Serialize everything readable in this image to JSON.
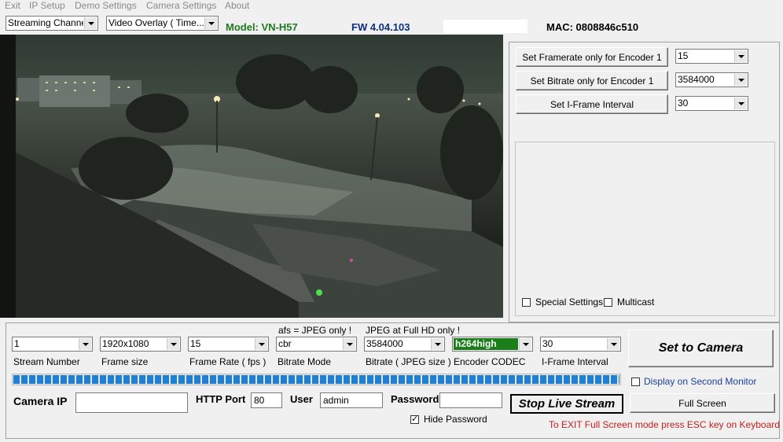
{
  "menu": {
    "items": [
      "Exit",
      "IP Setup",
      "Demo Settings",
      "Camera Settings",
      "About"
    ]
  },
  "toolbar": {
    "channel_select": "Streaming Channel",
    "overlay_select": "Video Overlay ( Time... )",
    "model": "Model: VN-H57",
    "firmware": "FW 4.04.103",
    "mac": "MAC: 0808846c510"
  },
  "encoder_panel": {
    "framerate_button": "Set Framerate only for Encoder 1",
    "framerate_value": "15",
    "bitrate_button": "Set Bitrate only for Encoder 1",
    "bitrate_value": "3584000",
    "iframe_button": "Set I-Frame Interval",
    "iframe_value": "30",
    "special_settings": "Special Settings",
    "multicast": "Multicast"
  },
  "stream": {
    "afs_note": "afs = JPEG only !",
    "jpeg_note": "JPEG at Full HD only !",
    "stream_number": {
      "value": "1",
      "label": "Stream Number"
    },
    "frame_size": {
      "value": "1920x1080",
      "label": "Frame size"
    },
    "frame_rate": {
      "value": "15",
      "label": "Frame Rate ( fps )"
    },
    "bitrate_mode": {
      "value": "cbr",
      "label": "Bitrate Mode"
    },
    "bitrate": {
      "value": "3584000",
      "label": "Bitrate ( JPEG size )"
    },
    "codec": {
      "value": "h264high",
      "label": "Encoder CODEC"
    },
    "iframe": {
      "value": "30",
      "label": "I-Frame Interval"
    },
    "set_to_camera": "Set to Camera",
    "display_second_monitor": "Display on Second Monitor",
    "progress": 1.0
  },
  "connection": {
    "camera_ip_label": "Camera IP",
    "camera_ip_value": "",
    "http_port_label": "HTTP Port",
    "http_port_value": "80",
    "user_label": "User",
    "user_value": "admin",
    "password_label": "Password",
    "password_value": "",
    "hide_password": "Hide Password",
    "stop_stream": "Stop Live Stream",
    "full_screen": "Full Screen",
    "exit_hint": "To EXIT Full Screen mode press ESC key on Keyboard"
  },
  "colors": {
    "model": "#1f7a1f",
    "firmware": "#0d2f80",
    "codec_bg": "#1a7f1a",
    "progress": "#1e7fd6",
    "hint": "#c81e1e",
    "link_blue": "#1a3f9e"
  }
}
